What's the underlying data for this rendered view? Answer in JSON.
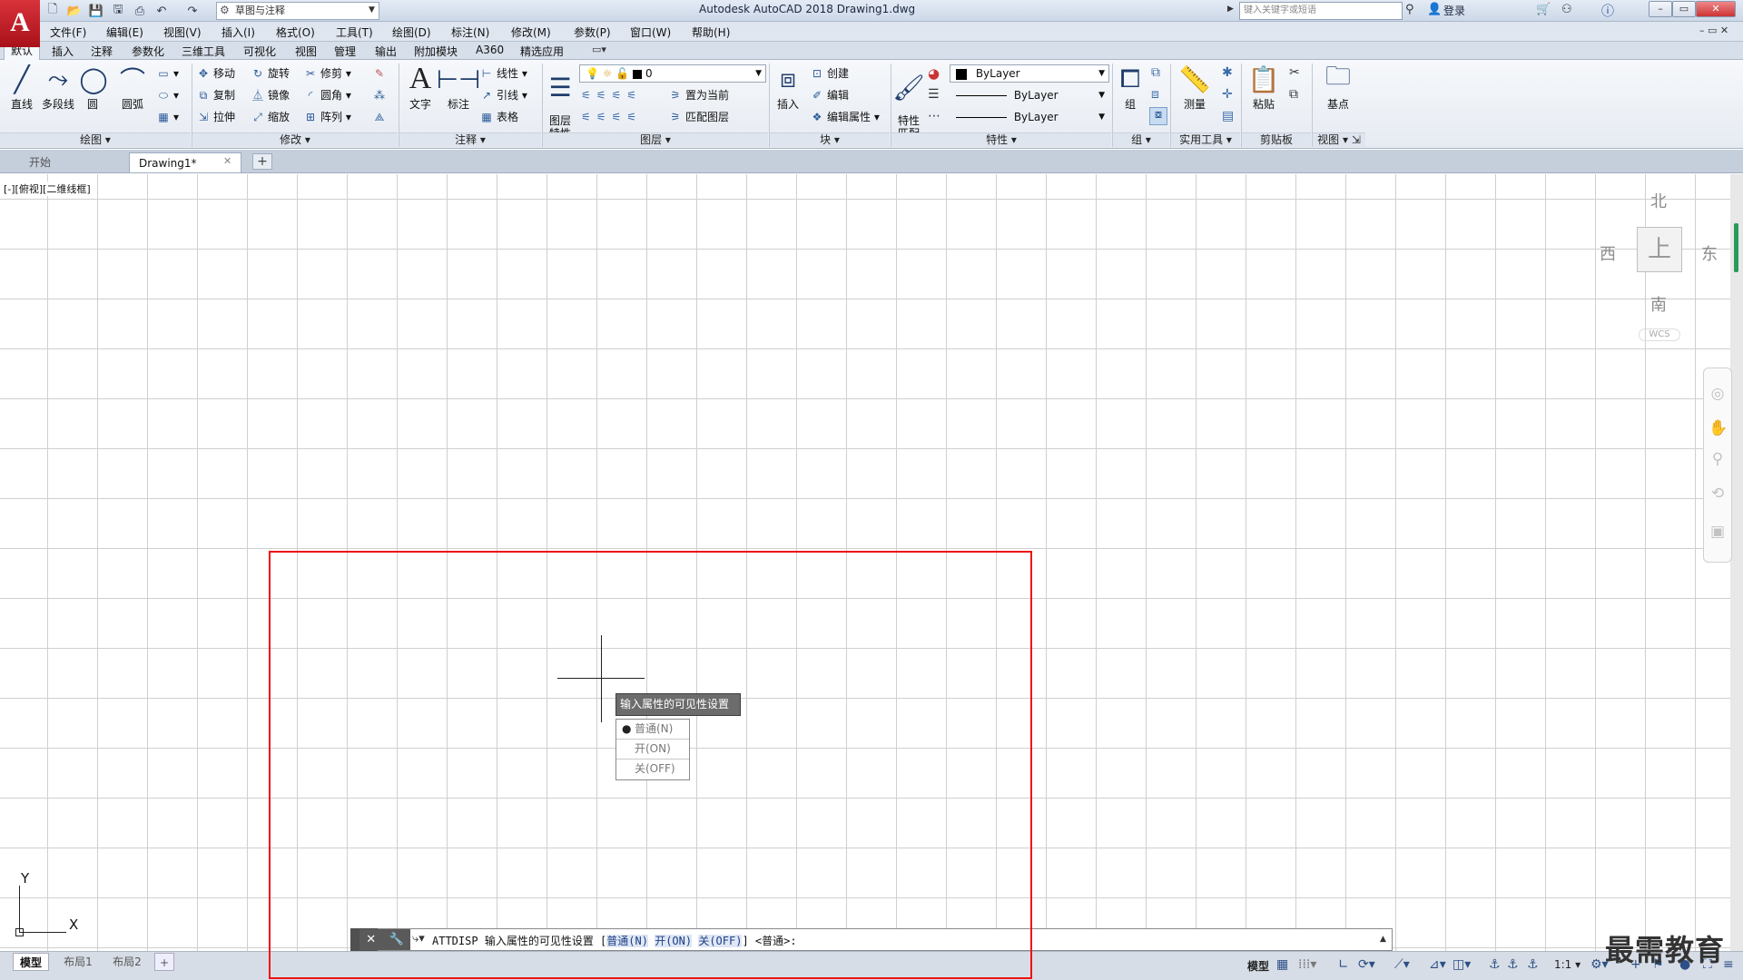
{
  "title_bar": {
    "app_logo": "A",
    "workspace": "草图与注释",
    "title": "Autodesk AutoCAD 2018    Drawing1.dwg",
    "search_placeholder": "键入关键字或短语",
    "login": "登录"
  },
  "menus": [
    "文件(F)",
    "编辑(E)",
    "视图(V)",
    "插入(I)",
    "格式(O)",
    "工具(T)",
    "绘图(D)",
    "标注(N)",
    "修改(M)",
    "参数(P)",
    "窗口(W)",
    "帮助(H)"
  ],
  "ribbon_tabs": [
    "默认",
    "插入",
    "注释",
    "参数化",
    "三维工具",
    "可视化",
    "视图",
    "管理",
    "输出",
    "附加模块",
    "A360",
    "精选应用"
  ],
  "ribbon": {
    "draw": {
      "label": "绘图",
      "line": "直线",
      "polyline": "多段线",
      "circle": "圆",
      "arc": "圆弧"
    },
    "modify": {
      "label": "修改",
      "move": "移动",
      "rotate": "旋转",
      "trim": "修剪",
      "copy": "复制",
      "mirror": "镜像",
      "fillet": "圆角",
      "stretch": "拉伸",
      "scale": "缩放",
      "array": "阵列"
    },
    "annotation": {
      "label": "注释",
      "text": "文字",
      "dimension": "标注",
      "linear": "线性",
      "leader": "引线",
      "table": "表格"
    },
    "layers": {
      "label": "图层",
      "layer_props": "图层\n特性",
      "current_layer": "0",
      "make_current": "置为当前",
      "match_layer": "匹配图层"
    },
    "block": {
      "label": "块",
      "insert": "插入",
      "create": "创建",
      "edit": "编辑",
      "edit_attr": "编辑属性"
    },
    "properties": {
      "label": "特性",
      "match": "特性\n匹配",
      "color": "ByLayer",
      "linetype": "ByLayer",
      "lineweight": "ByLayer"
    },
    "groups": {
      "label": "组",
      "group": "组"
    },
    "utilities": {
      "label": "实用工具",
      "measure": "测量"
    },
    "clipboard": {
      "label": "剪贴板",
      "paste": "粘贴"
    },
    "view": {
      "label": "视图",
      "base": "基点"
    }
  },
  "doc_tabs": {
    "start": "开始",
    "drawing": "Drawing1*"
  },
  "viewport_label": "[-][俯视][二维线框]",
  "viewcube": {
    "north": "北",
    "south": "南",
    "east": "东",
    "west": "西",
    "top": "上",
    "wcs": "WCS"
  },
  "ucs": {
    "x": "X",
    "y": "Y"
  },
  "dynamic_input": {
    "prompt": "输入属性的可见性设置",
    "options": [
      {
        "label": "普通(N)",
        "selected": true
      },
      {
        "label": "开(ON)",
        "selected": false
      },
      {
        "label": "关(OFF)",
        "selected": false
      }
    ]
  },
  "command_line": {
    "command": "ATTDISP",
    "prompt": "输入属性的可见性设置 [",
    "opt_normal": "普通(N)",
    "opt_on": "开(ON)",
    "opt_off": "关(OFF)",
    "tail": "] <普通>:"
  },
  "layout_tabs": [
    "模型",
    "布局1",
    "布局2"
  ],
  "status": {
    "model": "模型",
    "scale": "1:1"
  },
  "watermark": "最需教育",
  "colors": {
    "highlight": "#ee1111",
    "logo": "#c0161e"
  }
}
